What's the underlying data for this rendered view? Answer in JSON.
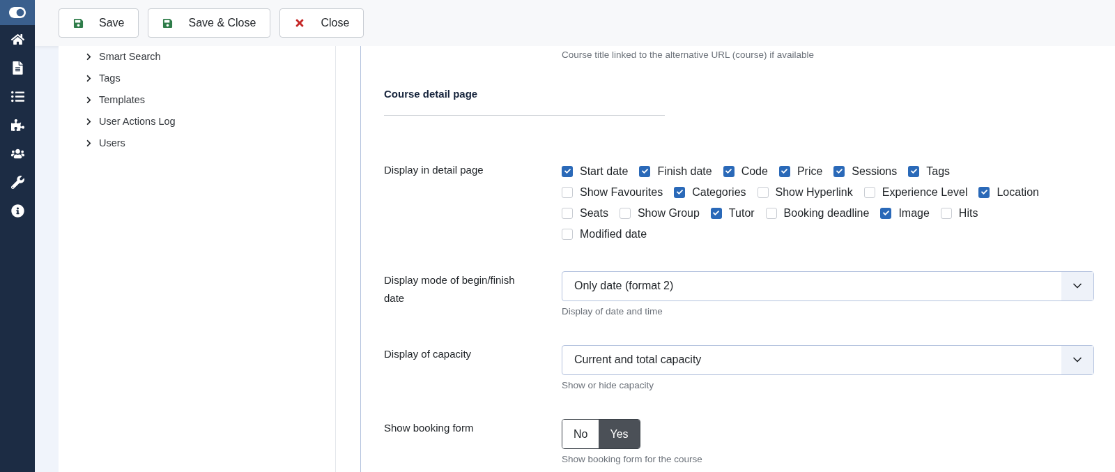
{
  "toolbar": {
    "buttons": [
      {
        "label": "Save",
        "kind": "save"
      },
      {
        "label": "Save & Close",
        "kind": "save"
      },
      {
        "label": "Close",
        "kind": "close"
      }
    ]
  },
  "tree": {
    "items": [
      {
        "label": "Smart Search",
        "expanded": false
      },
      {
        "label": "Tags",
        "expanded": false
      },
      {
        "label": "Templates",
        "expanded": false
      },
      {
        "label": "User Actions Log",
        "expanded": false
      },
      {
        "label": "Users",
        "expanded": false
      }
    ]
  },
  "form": {
    "top_hint": "Course title linked to the alternative URL (course) if available",
    "section_title": "Course detail page",
    "fields": [
      {
        "kind": "checkboxes",
        "label": "Display in detail page",
        "options": [
          {
            "label": "Start date",
            "checked": true
          },
          {
            "label": "Finish date",
            "checked": true
          },
          {
            "label": "Code",
            "checked": true
          },
          {
            "label": "Price",
            "checked": true
          },
          {
            "label": "Sessions",
            "checked": true
          },
          {
            "label": "Tags",
            "checked": true
          },
          {
            "label": "Show Favourites",
            "checked": false
          },
          {
            "label": "Categories",
            "checked": true
          },
          {
            "label": "Show Hyperlink",
            "checked": false
          },
          {
            "label": "Experience Level",
            "checked": false
          },
          {
            "label": "Location",
            "checked": true
          },
          {
            "label": "Seats",
            "checked": false
          },
          {
            "label": "Show Group",
            "checked": false
          },
          {
            "label": "Tutor",
            "checked": true
          },
          {
            "label": "Booking deadline",
            "checked": false
          },
          {
            "label": "Image",
            "checked": true
          },
          {
            "label": "Hits",
            "checked": false
          },
          {
            "label": "Modified date",
            "checked": false
          }
        ]
      },
      {
        "kind": "select",
        "label": "Display mode of begin/finish date",
        "value": "Only date (format 2)",
        "hint": "Display of date and time"
      },
      {
        "kind": "select",
        "label": "Display of capacity",
        "value": "Current and total capacity",
        "hint": "Show or hide capacity"
      },
      {
        "kind": "toggle",
        "label": "Show booking form",
        "options": [
          {
            "label": "No",
            "selected": false
          },
          {
            "label": "Yes",
            "selected": true
          }
        ],
        "hint": "Show booking form for the course"
      }
    ]
  }
}
